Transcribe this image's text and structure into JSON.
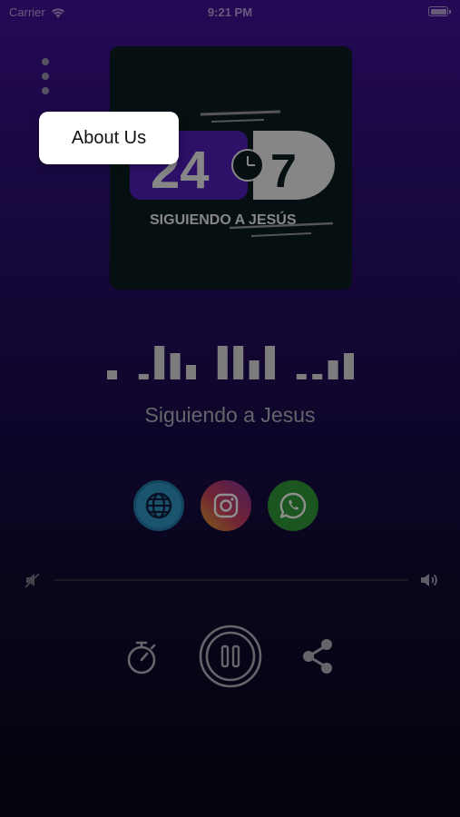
{
  "status_bar": {
    "carrier": "Carrier",
    "time": "9:21 PM"
  },
  "popup_menu": {
    "items": [
      {
        "label": "About Us"
      }
    ]
  },
  "cover": {
    "logo_number_left": "24",
    "logo_number_right": "7",
    "logo_tagline": "SIGUIENDO A JESÚS"
  },
  "player": {
    "station_name": "Siguiendo a Jesus",
    "state": "playing",
    "equalizer_levels": [
      0.25,
      0,
      0.15,
      0.9,
      0.7,
      0.4,
      0,
      0.9,
      0.9,
      0.5,
      0.9,
      0,
      0.15,
      0.15,
      0.5,
      0.7
    ]
  },
  "social": [
    {
      "icon": "globe-icon",
      "name": "website"
    },
    {
      "icon": "instagram-icon",
      "name": "instagram"
    },
    {
      "icon": "whatsapp-icon",
      "name": "whatsapp"
    }
  ],
  "volume": {
    "level": 0
  },
  "colors": {
    "accent": "#3b0f8a",
    "equalizer_bar": "#c9c9c9",
    "text_secondary": "#a5a2ad"
  }
}
